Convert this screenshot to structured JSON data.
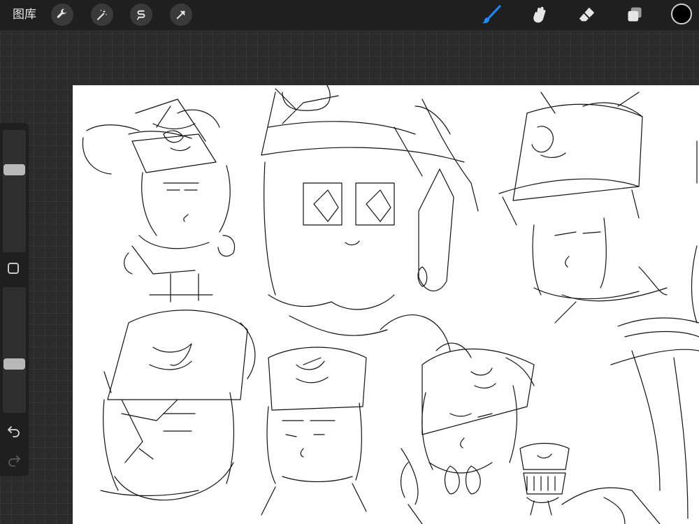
{
  "app": {
    "gallery_label": "图库"
  },
  "toolbar_left": [
    {
      "name": "actions",
      "icon": "wrench-icon"
    },
    {
      "name": "adjustments",
      "icon": "magic-wand-icon"
    },
    {
      "name": "selection",
      "icon": "selection-s-icon"
    },
    {
      "name": "transform",
      "icon": "arrow-cursor-icon"
    }
  ],
  "toolbar_right": [
    {
      "name": "brush",
      "icon": "brush-icon",
      "active": true,
      "color": "#1a8cff"
    },
    {
      "name": "smudge",
      "icon": "smudge-hand-icon",
      "active": false
    },
    {
      "name": "eraser",
      "icon": "eraser-icon",
      "active": false
    },
    {
      "name": "layers",
      "icon": "layers-icon",
      "active": false
    }
  ],
  "current_color": "#000000",
  "sidebar": {
    "brush_size_level": 0.31,
    "brush_opacity_level": 0.62,
    "undo_icon": "undo-arrow-icon",
    "redo_icon": "redo-arrow-icon",
    "modify_icon": "square-outline-icon"
  },
  "colors": {
    "toolbar_bg": "#1f1f1f",
    "workspace_bg": "#2b2b2b",
    "canvas_bg": "#ffffff",
    "ink": "#111111"
  }
}
